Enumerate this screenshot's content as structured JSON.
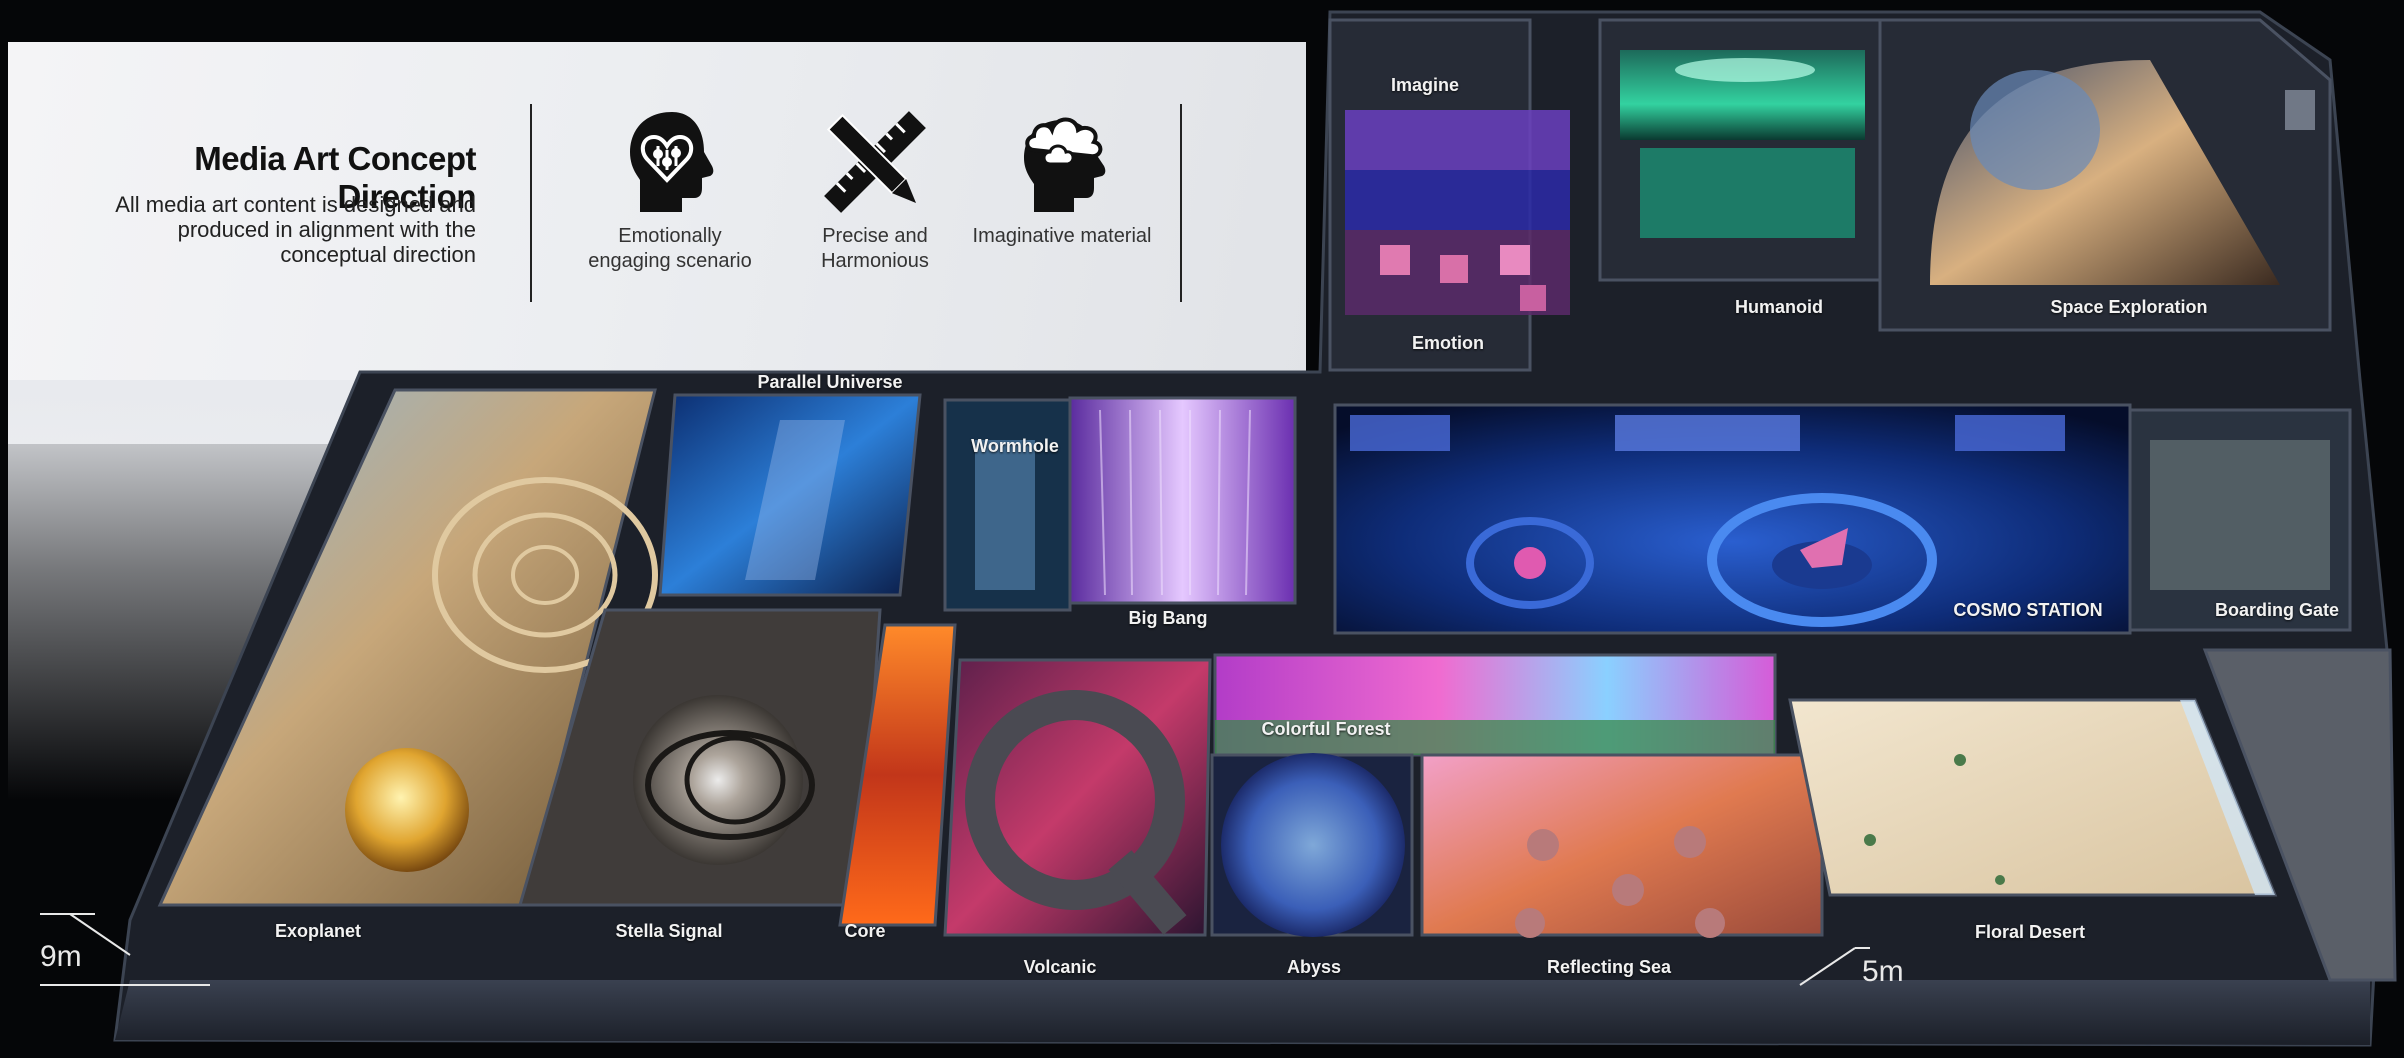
{
  "header": {
    "title": "Media Art Concept Direction",
    "subtitle": "All media art content is designed and produced in alignment with the conceptual direction"
  },
  "concepts": [
    {
      "label": "Emotionally engaging scenario",
      "icon": "heart-head-icon"
    },
    {
      "label": "Precise and Harmonious",
      "icon": "ruler-pencil-icon"
    },
    {
      "label": "Imaginative material",
      "icon": "cloud-head-icon"
    }
  ],
  "rooms": {
    "imagine": "Imagine",
    "emotion": "Emotion",
    "humanoid": "Humanoid",
    "space_exploration": "Space Exploration",
    "parallel_universe": "Parallel Universe",
    "wormhole": "Wormhole",
    "big_bang": "Big Bang",
    "cosmo_station": "COSMO STATION",
    "boarding_gate": "Boarding Gate",
    "colorful_forest": "Colorful Forest",
    "exoplanet": "Exoplanet",
    "stella_signal": "Stella Signal",
    "core": "Core",
    "volcanic": "Volcanic",
    "abyss": "Abyss",
    "reflecting_sea": "Reflecting Sea",
    "floral_desert": "Floral Desert"
  },
  "scale": {
    "height_label": "9m",
    "width_label": "5m"
  }
}
